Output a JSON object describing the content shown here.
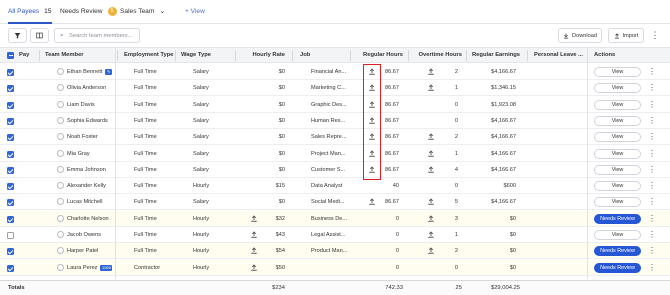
{
  "tabs": [
    {
      "label": "All Payees",
      "count": "15"
    },
    {
      "label": "Needs Review",
      "badge": "5"
    },
    {
      "label": "Sales Team"
    },
    {
      "label": "+ View"
    }
  ],
  "toolbar": {
    "search_placeholder": "Search team members...",
    "download_label": "Download",
    "import_label": "Import",
    "icons": [
      "filter-icon",
      "columns-icon",
      "search-icon",
      "download-icon",
      "upload-icon",
      "more-vertical-icon"
    ]
  },
  "columns": {
    "pay": "Pay",
    "team_member": "Team Member",
    "employment_type": "Employment Type",
    "wage_type": "Wage Type",
    "hourly_rate": "Hourly Rate",
    "job": "Job",
    "regular_hours": "Regular Hours",
    "overtime_hours": "Overtime Hours",
    "regular_earnings": "Regular Earnings",
    "personal_leave": "Personal Leave ...",
    "actions": "Actions"
  },
  "rows": [
    {
      "checked": true,
      "name": "Ethan Bennett",
      "tag": "✎",
      "employment": "Full Time",
      "wage": "Salary",
      "rate": "$0",
      "rate_upload": false,
      "job": "Financial An...",
      "reg_upload": true,
      "reg_hours": "86.67",
      "ot_upload": true,
      "ot_hours": "2",
      "earnings": "$4,166.67",
      "action": "View",
      "highlight": false
    },
    {
      "checked": true,
      "name": "Olivia Anderson",
      "employment": "Full Time",
      "wage": "Salary",
      "rate": "$0",
      "rate_upload": false,
      "job": "Marketing C...",
      "reg_upload": true,
      "reg_hours": "86.67",
      "ot_upload": true,
      "ot_hours": "1",
      "earnings": "$1,346.15",
      "action": "View",
      "highlight": false
    },
    {
      "checked": true,
      "name": "Liam Davis",
      "employment": "Full Time",
      "wage": "Salary",
      "rate": "$0",
      "rate_upload": false,
      "job": "Graphic Des...",
      "reg_upload": true,
      "reg_hours": "86.67",
      "ot_upload": false,
      "ot_hours": "0",
      "earnings": "$1,923.08",
      "action": "View",
      "highlight": false
    },
    {
      "checked": true,
      "name": "Sophia Edwards",
      "employment": "Full Time",
      "wage": "Salary",
      "rate": "$0",
      "rate_upload": false,
      "job": "Human Res...",
      "reg_upload": true,
      "reg_hours": "86.67",
      "ot_upload": false,
      "ot_hours": "0",
      "earnings": "$4,166.67",
      "action": "View",
      "highlight": false
    },
    {
      "checked": true,
      "name": "Noah Foster",
      "employment": "Full Time",
      "wage": "Salary",
      "rate": "$0",
      "rate_upload": false,
      "job": "Sales Repre...",
      "reg_upload": true,
      "reg_hours": "86.67",
      "ot_upload": true,
      "ot_hours": "2",
      "earnings": "$4,166.67",
      "action": "View",
      "highlight": false
    },
    {
      "checked": true,
      "name": "Mia Gray",
      "employment": "Full Time",
      "wage": "Salary",
      "rate": "$0",
      "rate_upload": false,
      "job": "Project Man...",
      "reg_upload": true,
      "reg_hours": "86.67",
      "ot_upload": true,
      "ot_hours": "1",
      "earnings": "$4,166.67",
      "action": "View",
      "highlight": false
    },
    {
      "checked": true,
      "name": "Emma Johnson",
      "employment": "Full Time",
      "wage": "Salary",
      "rate": "$0",
      "rate_upload": false,
      "job": "Customer S...",
      "reg_upload": true,
      "reg_hours": "86.67",
      "ot_upload": true,
      "ot_hours": "4",
      "earnings": "$4,166.67",
      "action": "View",
      "highlight": false
    },
    {
      "checked": true,
      "name": "Alexander Kelly",
      "employment": "Full Time",
      "wage": "Hourly",
      "rate": "$15",
      "rate_upload": false,
      "job": "Data Analyst",
      "reg_upload": false,
      "reg_hours": "40",
      "ot_upload": false,
      "ot_hours": "0",
      "earnings": "$600",
      "action": "View",
      "highlight": false
    },
    {
      "checked": true,
      "name": "Lucas Mitchell",
      "employment": "Full Time",
      "wage": "Salary",
      "rate": "$0",
      "rate_upload": false,
      "job": "Social Medi...",
      "reg_upload": true,
      "reg_hours": "86.67",
      "ot_upload": true,
      "ot_hours": "5",
      "earnings": "$4,166.67",
      "action": "View",
      "highlight": false
    },
    {
      "checked": true,
      "name": "Charlotte Nelson",
      "employment": "Full Time",
      "wage": "Hourly",
      "rate": "$32",
      "rate_upload": true,
      "job": "Business De...",
      "reg_upload": false,
      "reg_hours": "0",
      "ot_upload": true,
      "ot_hours": "3",
      "earnings": "$0",
      "action": "Needs Review",
      "highlight": true
    },
    {
      "checked": false,
      "name": "Jacob Owens",
      "employment": "Full Time",
      "wage": "Hourly",
      "rate": "$43",
      "rate_upload": true,
      "job": "Legal Assist...",
      "reg_upload": false,
      "reg_hours": "0",
      "ot_upload": true,
      "ot_hours": "1",
      "earnings": "$0",
      "action": "View",
      "highlight": false
    },
    {
      "checked": true,
      "name": "Harper Patel",
      "employment": "Full Time",
      "wage": "Hourly",
      "rate": "$54",
      "rate_upload": true,
      "job": "Product Man...",
      "reg_upload": false,
      "reg_hours": "0",
      "ot_upload": true,
      "ot_hours": "2",
      "earnings": "$0",
      "action": "Needs Review",
      "highlight": true
    },
    {
      "checked": true,
      "name": "Laura Perez",
      "tag": "1099",
      "employment": "Contractor",
      "wage": "Hourly",
      "rate": "$50",
      "rate_upload": true,
      "job": "",
      "reg_upload": false,
      "reg_hours": "0",
      "ot_upload": false,
      "ot_hours": "0",
      "earnings": "$0",
      "action": "Needs Review",
      "highlight": true
    }
  ],
  "totals": {
    "label": "Totals",
    "hourly_rate": "$234",
    "regular_hours": "742.33",
    "overtime_hours": "25",
    "regular_earnings": "$29,004.25"
  },
  "colors": {
    "accent": "#2456d6",
    "badge": "#f0b13a",
    "highlight_row": "#fefdf0",
    "annotation_box": "#e02020"
  }
}
